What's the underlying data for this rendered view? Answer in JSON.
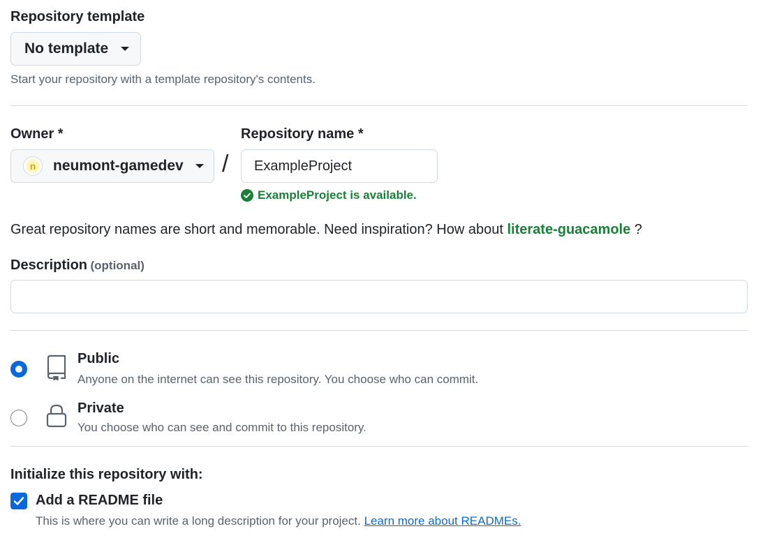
{
  "template": {
    "label": "Repository template",
    "selected": "No template",
    "hint": "Start your repository with a template repository's contents."
  },
  "owner": {
    "label": "Owner *",
    "selected": "neumont-gamedev",
    "avatar_letter": "n"
  },
  "separator": "/",
  "repo_name": {
    "label": "Repository name *",
    "value": "ExampleProject",
    "available_msg": "ExampleProject is available."
  },
  "suggestion": {
    "prefix": "Great repository names are short and memorable. Need inspiration? How about",
    "name": "literate-guacamole",
    "suffix": "?"
  },
  "description": {
    "label": "Description",
    "optional": "(optional)",
    "value": ""
  },
  "visibility": {
    "public": {
      "title": "Public",
      "desc": "Anyone on the internet can see this repository. You choose who can commit.",
      "selected": true
    },
    "private": {
      "title": "Private",
      "desc": "You choose who can see and commit to this repository.",
      "selected": false
    }
  },
  "initialize": {
    "label": "Initialize this repository with:",
    "readme_label": "Add a README file",
    "readme_checked": true,
    "readme_desc": "This is where you can write a long description for your project.",
    "readme_link": "Learn more about READMEs."
  },
  "colors": {
    "accent": "#0969da",
    "success": "#1a7f37",
    "border": "#d1d9e0",
    "muted_text": "#59636e"
  }
}
